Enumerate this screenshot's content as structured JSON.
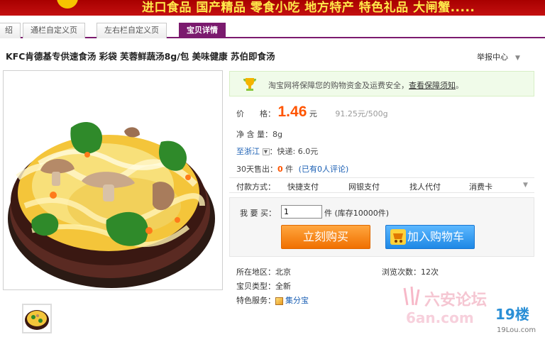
{
  "banner": {
    "categories": "进口食品   国产精品   零食小吃   地方特产   特色礼品   大闸蟹....."
  },
  "tabs": [
    {
      "label": "绍"
    },
    {
      "label": "通栏自定义页"
    },
    {
      "label": "左右栏自定义页"
    },
    {
      "label": "宝贝详情"
    }
  ],
  "product": {
    "title": "KFC肯德基专供速食汤 彩袋 芙蓉鲜蔬汤8g/包 美味健康 苏伯即食汤",
    "report": "举报中心"
  },
  "guarantee": {
    "text": "淘宝网将保障您的购物资金及运费安全，",
    "link": "查看保障须知",
    "end": "。"
  },
  "price": {
    "label": "价　　格：",
    "value": "1.46",
    "unit": "元",
    "per_unit": "91.25元/500g"
  },
  "net_weight": {
    "label": "净 含 量：",
    "value": "8g"
  },
  "shipping": {
    "to": "至浙江",
    "method": "：快递: 6.0元"
  },
  "sales": {
    "label": "30天售出：",
    "count": "0",
    "unit": "件",
    "reviews": "(已有0人评论)"
  },
  "payment": {
    "label": "付款方式：",
    "methods": [
      "快捷支付",
      "网银支付",
      "找人代付",
      "消费卡"
    ]
  },
  "purchase": {
    "qty_label": "我 要 买：",
    "qty_value": "1",
    "stock": "件 (库存10000件)",
    "buy_label": "立刻购买",
    "cart_label": "加入购物车"
  },
  "details": {
    "location_label": "所在地区：",
    "location": "北京",
    "views_label": "浏览次数：",
    "views": "12次",
    "type_label": "宝贝类型：",
    "type": "全新",
    "service_label": "特色服务：",
    "service": "集分宝"
  },
  "watermarks": {
    "forum": "六安论坛",
    "forum_url": "6an.com",
    "site": "19楼",
    "site_url": "19Lou.com"
  },
  "colors": {
    "accent": "#7b1a6e",
    "price": "#ff5500",
    "buy": "#f07000",
    "cart": "#1e88e5"
  }
}
